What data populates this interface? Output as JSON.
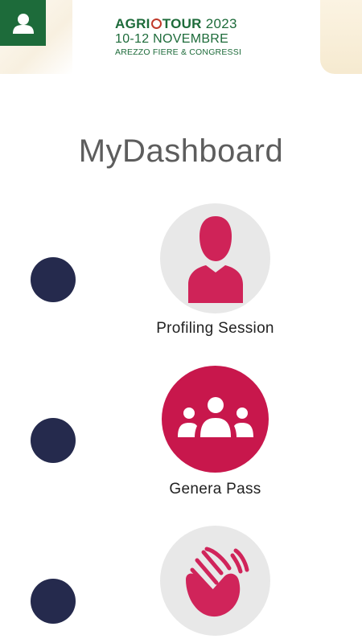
{
  "header": {
    "brand_name_part1": "AGRI",
    "brand_name_part2": "TOUR",
    "brand_year": "2023",
    "dates": "10-12 NOVEMBRE",
    "venue": "AREZZO FIERE & CONGRESSI",
    "user_icon": "user-icon",
    "colors": {
      "brand_green": "#1d6b3a",
      "accent_red": "#c0392b"
    }
  },
  "page": {
    "title": "MyDashboard"
  },
  "cards": [
    {
      "label": "Profiling Session",
      "icon": "person-icon",
      "style": "grey-circle-red-icon"
    },
    {
      "label": "Genera Pass",
      "icon": "group-icon",
      "style": "red-circle-white-icon"
    },
    {
      "label": "",
      "icon": "clapping-hands-icon",
      "style": "grey-circle-red-icon"
    }
  ],
  "colors": {
    "accent": "#c8174c",
    "dot": "#252a4d",
    "circle_grey": "#e8e8e8",
    "title": "#5d5d5d"
  }
}
